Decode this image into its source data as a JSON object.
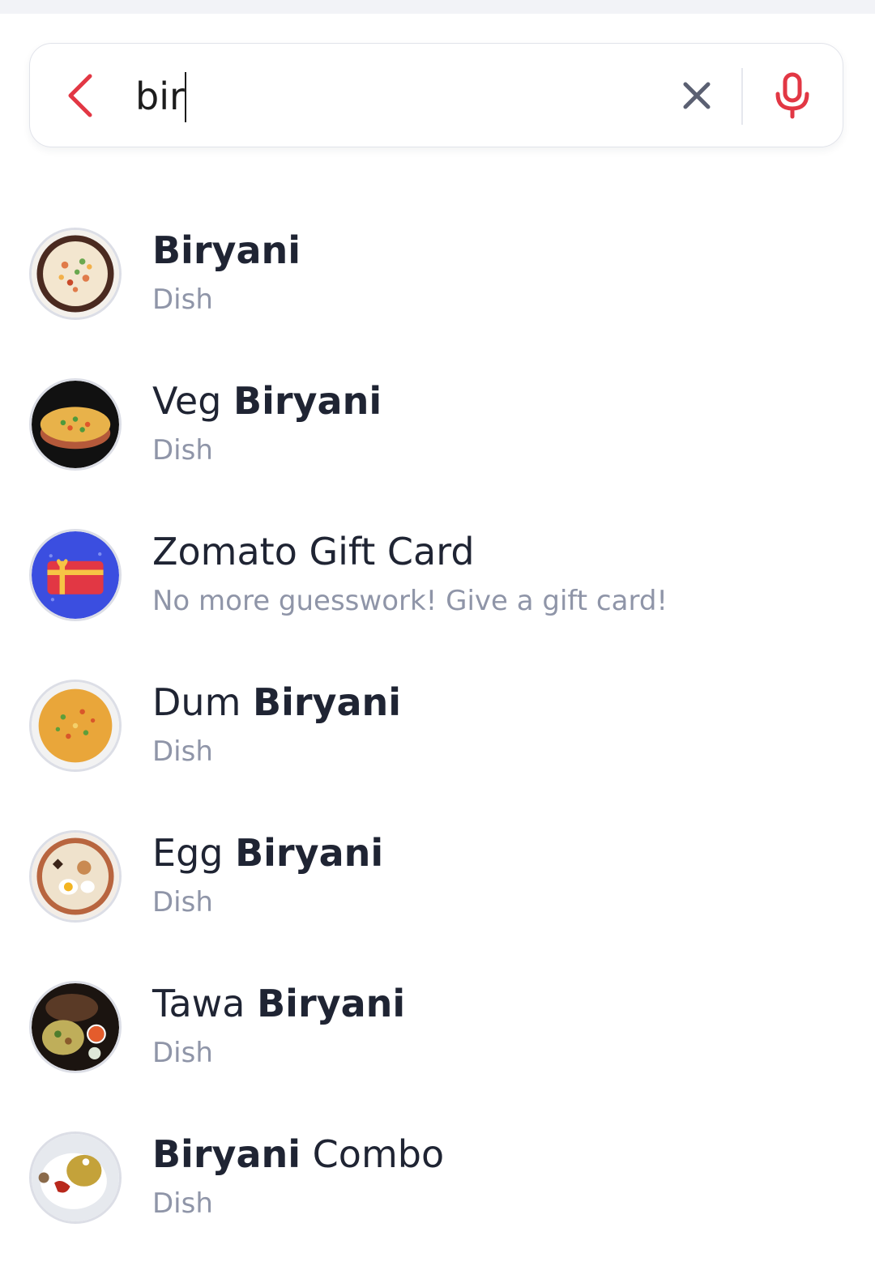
{
  "search": {
    "query": "bir",
    "back_icon": "chevron-left-icon",
    "clear_icon": "close-icon",
    "mic_icon": "microphone-icon",
    "accent_color": "#e23744"
  },
  "results": [
    {
      "title_pre": "",
      "title_match": "Biryani",
      "title_post": "",
      "subtitle": "Dish",
      "thumb": "biryani-plate"
    },
    {
      "title_pre": "Veg ",
      "title_match": "Biryani",
      "title_post": "",
      "subtitle": "Dish",
      "thumb": "veg-biryani-pot"
    },
    {
      "title_pre": "Zomato Gift Card",
      "title_match": "",
      "title_post": "",
      "subtitle": "No more guesswork! Give a gift card!",
      "thumb": "gift-card-icon"
    },
    {
      "title_pre": "Dum ",
      "title_match": "Biryani",
      "title_post": "",
      "subtitle": "Dish",
      "thumb": "dum-biryani-plate"
    },
    {
      "title_pre": "Egg ",
      "title_match": "Biryani",
      "title_post": "",
      "subtitle": "Dish",
      "thumb": "egg-biryani-plate"
    },
    {
      "title_pre": "Tawa ",
      "title_match": "Biryani",
      "title_post": "",
      "subtitle": "Dish",
      "thumb": "tawa-biryani-spread"
    },
    {
      "title_pre": "",
      "title_match": "Biryani",
      "title_post": " Combo",
      "subtitle": "Dish",
      "thumb": "biryani-combo-plate"
    }
  ]
}
